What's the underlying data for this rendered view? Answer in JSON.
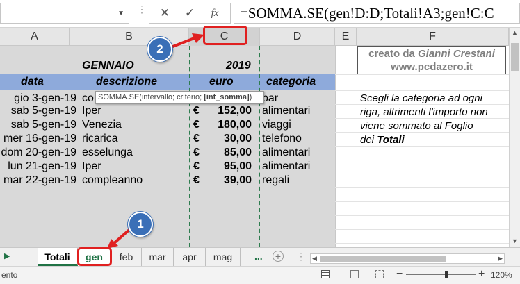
{
  "formula_bar": {
    "formula": "=SOMMA.SE(gen!D:D;Totali!A3;gen!C:C",
    "cancel_glyph": "✕",
    "enter_glyph": "✓",
    "function_glyph": "fx"
  },
  "columns": [
    "A",
    "B",
    "C",
    "D",
    "E",
    "F"
  ],
  "sheet": {
    "month": "GENNAIO",
    "year": "2019",
    "headers": {
      "data": "data",
      "descrizione": "descrizione",
      "euro": "euro",
      "categoria": "categoria"
    },
    "rows": [
      {
        "date": "gio 3-gen-19",
        "description": "co",
        "currency": "",
        "amount": "",
        "category": "bar"
      },
      {
        "date": "sab 5-gen-19",
        "description": "Iper",
        "currency": "€",
        "amount": "152,00",
        "category": "alimentari"
      },
      {
        "date": "sab 5-gen-19",
        "description": "Venezia",
        "currency": "€",
        "amount": "180,00",
        "category": "viaggi"
      },
      {
        "date": "mer 16-gen-19",
        "description": "ricarica",
        "currency": "€",
        "amount": "30,00",
        "category": "telefono"
      },
      {
        "date": "dom 20-gen-19",
        "description": "esselunga",
        "currency": "€",
        "amount": "85,00",
        "category": "alimentari"
      },
      {
        "date": "lun 21-gen-19",
        "description": "Iper",
        "currency": "€",
        "amount": "95,00",
        "category": "alimentari"
      },
      {
        "date": "mar 22-gen-19",
        "description": "compleanno",
        "currency": "€",
        "amount": "39,00",
        "category": "regali"
      }
    ]
  },
  "credit": {
    "prefix": "creato da ",
    "author": "Gianni Crestani",
    "site": "www.pcdazero.it"
  },
  "note": {
    "line1": "Scegli la categoria ad ogni",
    "line2": "riga, altrimenti l'importo non",
    "line3": "viene sommato al Foglio",
    "line4_prefix": "dei ",
    "line4_bold": "Totali"
  },
  "tooltip": {
    "text": "SOMMA.SE(intervallo; criterio; ",
    "bold": "[int_somma]",
    "suffix": ")"
  },
  "tabs": [
    "Totali",
    "gen",
    "feb",
    "mar",
    "apr",
    "mag"
  ],
  "tabs_more": "...",
  "tabs_add": "+",
  "active_tab": "gen",
  "status": {
    "left": "ento",
    "zoom": "120%"
  },
  "callouts": {
    "one": "1",
    "two": "2"
  },
  "colors": {
    "header_band": "#8eaadb",
    "sheet_fill": "#d9d9d9",
    "callout": "#3a6fb7",
    "highlight": "#e02020",
    "excel_green": "#217346"
  }
}
